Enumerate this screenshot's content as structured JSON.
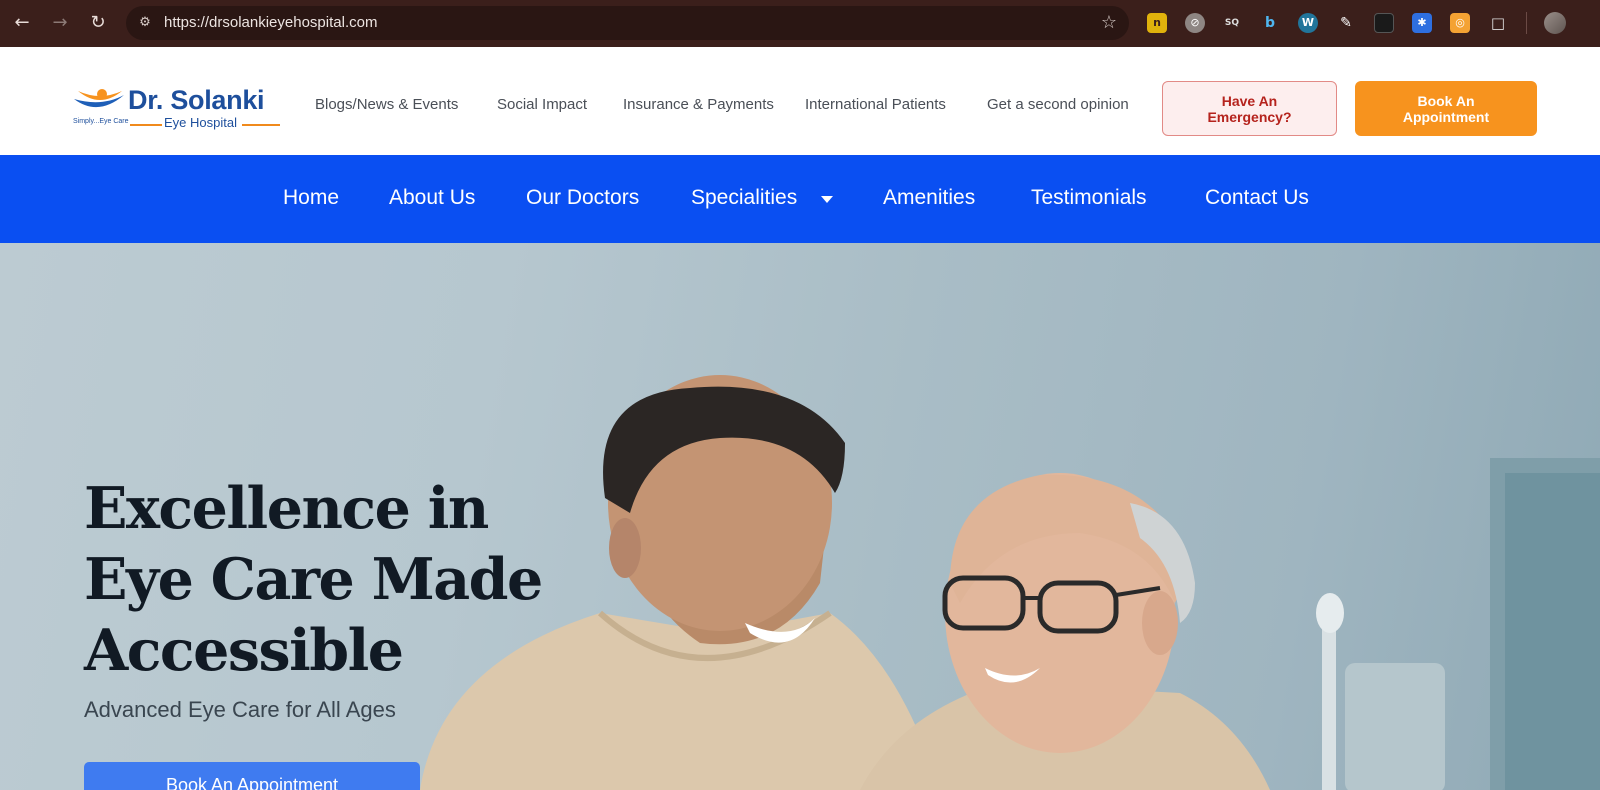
{
  "browser": {
    "url": "https://drsolankieyehospital.com",
    "back_icon": "arrow-left-icon",
    "forward_icon": "arrow-right-icon",
    "reload_icon": "reload-icon",
    "bookmark_icon": "star-icon",
    "extensions": [
      "extension-n-icon",
      "extension-grey-icon",
      "extension-seo-icon",
      "extension-b-icon",
      "extension-wordpress-icon",
      "extension-eyedropper-icon",
      "extension-dark-icon",
      "extension-blue-gear-icon",
      "extension-orange-icon",
      "extensions-puzzle-icon"
    ]
  },
  "header": {
    "logo": {
      "name": "Dr. Solanki",
      "subtitle": "Eye Hospital",
      "tagline": "Simply...Eye Care"
    },
    "top_links": [
      "Blogs/News & Events",
      "Social Impact",
      "Insurance & Payments",
      "International Patients",
      "Get a second opinion"
    ],
    "emergency_button": "Have An Emergency?",
    "book_button": "Book An Appointment"
  },
  "nav": {
    "items": [
      "Home",
      "About Us",
      "Our Doctors",
      "Specialities",
      "Amenities",
      "Testimonials",
      "Contact Us"
    ],
    "accent": "#0a4ff2"
  },
  "hero": {
    "title_lines": [
      "Excellence in",
      "Eye Care Made",
      "Accessible"
    ],
    "subtitle": "Advanced Eye Care for All Ages",
    "button": "Book An Appointment"
  },
  "colors": {
    "brand_blue": "#1e4f9c",
    "brand_orange": "#f7931e",
    "nav_blue": "#0a4ff2",
    "emergency_red": "#b5231d"
  }
}
